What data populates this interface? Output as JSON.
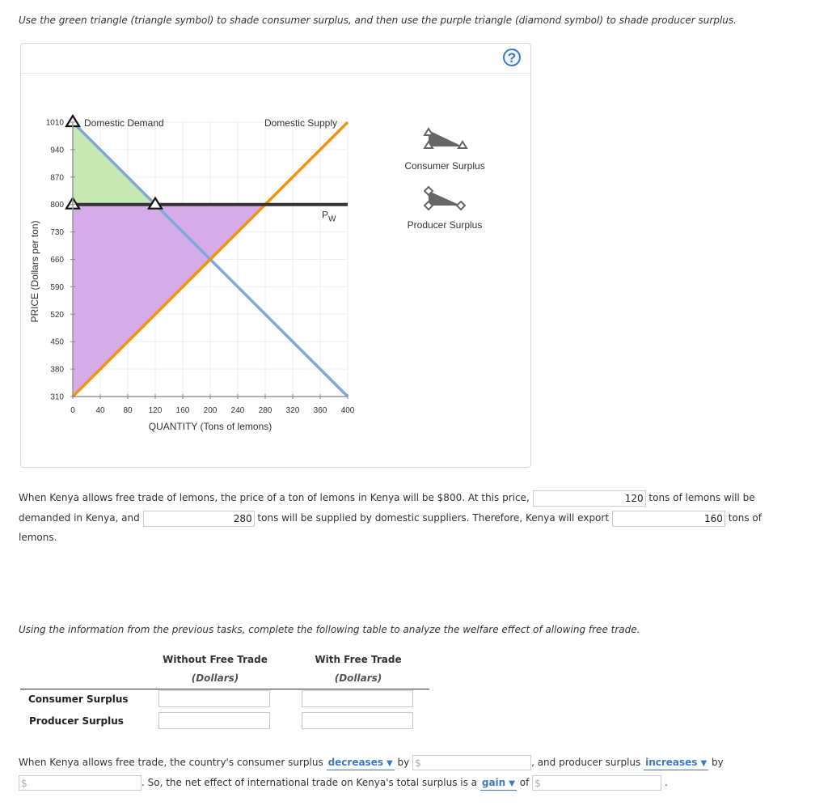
{
  "instructions": "Use the green triangle (triangle symbol) to shade consumer surplus, and then use the purple triangle (diamond symbol) to shade producer surplus.",
  "help_label": "?",
  "palette": {
    "consumer_surplus_tool": "Consumer Surplus",
    "producer_surplus_tool": "Producer Surplus"
  },
  "colors": {
    "demand": "#7fa9d6",
    "supply": "#f5930f",
    "world_price": "#333333",
    "consumer_fill": "#c5e8b0",
    "producer_fill": "#d3a8e6",
    "accent": "#3b7bbf"
  },
  "chart_data": {
    "type": "line",
    "xlabel": "QUANTITY (Tons of lemons)",
    "ylabel": "PRICE (Dollars per ton)",
    "xlim": [
      0,
      400
    ],
    "ylim": [
      310,
      1010
    ],
    "x_ticks": [
      0,
      40,
      80,
      120,
      160,
      200,
      240,
      280,
      320,
      360,
      400
    ],
    "y_ticks": [
      310,
      380,
      450,
      520,
      590,
      660,
      730,
      800,
      870,
      940,
      1010
    ],
    "grid": true,
    "series": [
      {
        "name": "Domestic Demand",
        "points": [
          [
            0,
            1010
          ],
          [
            400,
            310
          ]
        ]
      },
      {
        "name": "Domestic Supply",
        "points": [
          [
            0,
            310
          ],
          [
            400,
            1010
          ]
        ]
      },
      {
        "name": "PW",
        "points": [
          [
            0,
            800
          ],
          [
            400,
            800
          ]
        ]
      }
    ],
    "shaded_regions": [
      {
        "name": "Consumer Surplus",
        "vertices": [
          [
            0,
            1010
          ],
          [
            0,
            800
          ],
          [
            120,
            800
          ]
        ]
      },
      {
        "name": "Producer Surplus",
        "vertices": [
          [
            0,
            800
          ],
          [
            280,
            800
          ],
          [
            0,
            310
          ]
        ]
      }
    ],
    "labels": {
      "demand": "Domestic Demand",
      "supply": "Domestic Supply",
      "world_price": "P",
      "world_price_sub": "W"
    }
  },
  "q1": {
    "part1": "When Kenya allows free trade of lemons, the price of a ton of lemons in Kenya will be $800. At this price,",
    "demanded_value": "120",
    "part2": "tons of lemons will be",
    "part3": "demanded in Kenya, and",
    "supplied_value": "280",
    "part4": "tons will be supplied by domestic suppliers. Therefore, Kenya will export",
    "export_value": "160",
    "part5": "tons of",
    "part6": "lemons."
  },
  "q2": {
    "prompt": "Using the information from the previous tasks, complete the following table to analyze the welfare effect of allowing free trade.",
    "col1": "Without Free Trade",
    "col1_sub": "(Dollars)",
    "col2": "With Free Trade",
    "col2_sub": "(Dollars)",
    "rows": [
      {
        "label": "Consumer Surplus",
        "without": "",
        "with": ""
      },
      {
        "label": "Producer Surplus",
        "without": "",
        "with": ""
      }
    ]
  },
  "q3": {
    "part1": "When Kenya allows free trade, the country's consumer surplus",
    "cs_change": "decreases",
    "by1": "by",
    "part2": ", and producer surplus",
    "ps_change": "increases",
    "by2": "by",
    "part3": ". So, the net effect of international trade on Kenya's total surplus is a",
    "net_change": "gain",
    "of": "of",
    "end": ".",
    "currency_symbol": "$"
  }
}
